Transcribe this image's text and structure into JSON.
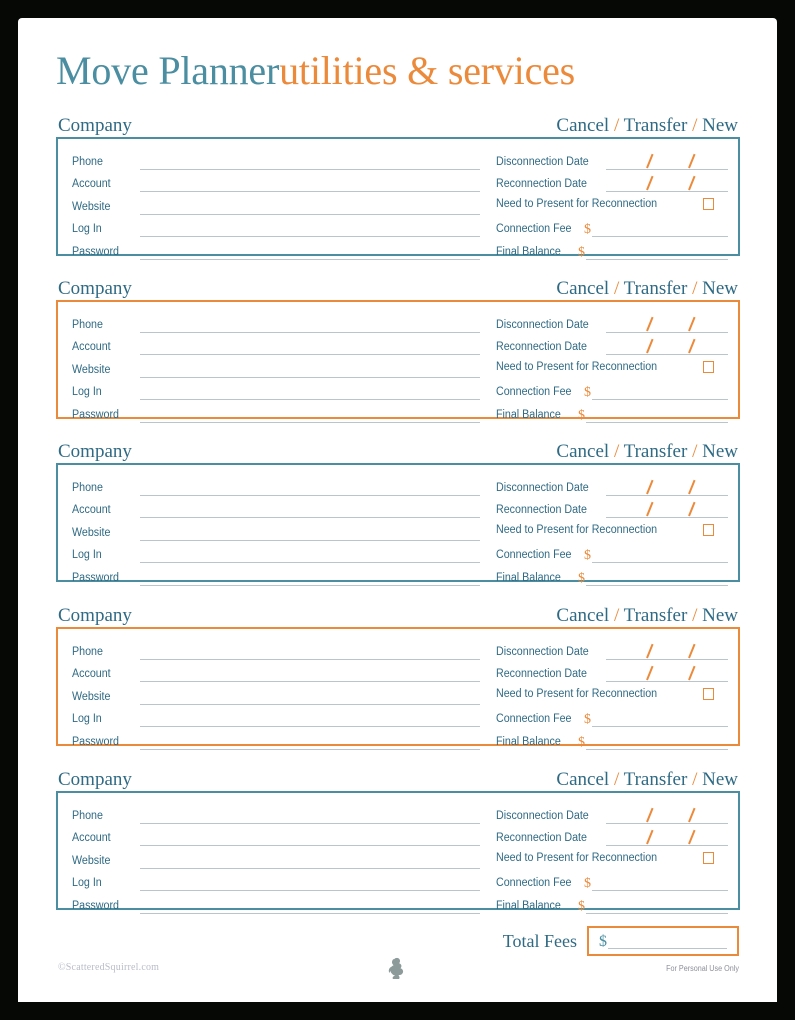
{
  "page": {
    "title_main": "Move Planner",
    "title_sub": "utilities & services"
  },
  "colors": {
    "teal": "#4b8ea1",
    "teal_text": "#2f6a84",
    "orange": "#ec8a3b",
    "rule": "#b9c5ca",
    "page_border": "#050805"
  },
  "section_header": {
    "company_label": "Company",
    "action_cancel": "Cancel",
    "action_transfer": "Transfer",
    "action_new": "New",
    "separator": "/"
  },
  "fields": {
    "left": [
      {
        "label": "Phone"
      },
      {
        "label": "Account"
      },
      {
        "label": "Website"
      },
      {
        "label": "Log In"
      },
      {
        "label": "Password"
      }
    ],
    "right": {
      "disconnection_date": "Disconnection Date",
      "reconnection_date": "Reconnection Date",
      "need_to_present": "Need to Present for Reconnection",
      "connection_fee": "Connection Fee",
      "final_balance": "Final Balance",
      "currency_symbol": "$",
      "date_separator": "/"
    }
  },
  "cards": [
    {
      "index": 1,
      "border_color": "teal"
    },
    {
      "index": 2,
      "border_color": "orange"
    },
    {
      "index": 3,
      "border_color": "teal"
    },
    {
      "index": 4,
      "border_color": "orange"
    },
    {
      "index": 5,
      "border_color": "teal"
    }
  ],
  "total": {
    "label": "Total Fees",
    "currency_symbol": "$",
    "value": ""
  },
  "footer": {
    "credit": "©ScatteredSquirrel.com",
    "usage": "For Personal Use Only",
    "logo_name": "squirrel-logo"
  }
}
